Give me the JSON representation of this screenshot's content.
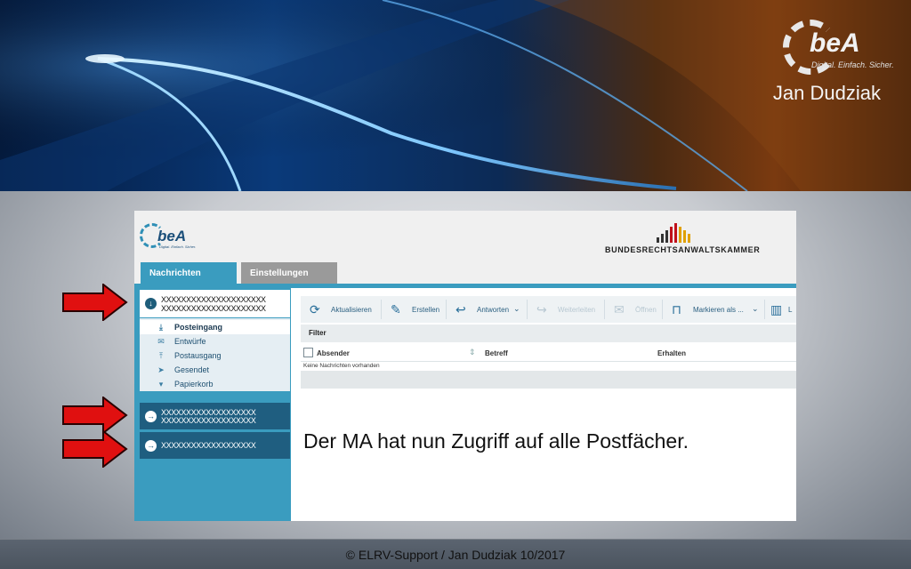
{
  "banner": {
    "brand_word": "beA",
    "brand_tagline": "Digital. Einfach. Sicher.",
    "author": "Jan Dudziak"
  },
  "app": {
    "logo_word": "beA",
    "logo_tagline": "Digital. Einfach. Sicher.",
    "partner_name": "BUNDESRECHTSANWALTSKAMMER",
    "tabs": [
      {
        "label": "Nachrichten",
        "active": true
      },
      {
        "label": "Einstellungen",
        "active": false
      }
    ],
    "account_primary": {
      "line1": "XXXXXXXXXXXXXXXXXXXXX",
      "line2": "XXXXXXXXXXXXXXXXXXXXX"
    },
    "folders": [
      {
        "label": "Posteingang",
        "icon": "inbox-icon",
        "selected": true
      },
      {
        "label": "Entwürfe",
        "icon": "envelope-icon",
        "selected": false
      },
      {
        "label": "Postausgang",
        "icon": "outbox-icon",
        "selected": false
      },
      {
        "label": "Gesendet",
        "icon": "send-icon",
        "selected": false
      },
      {
        "label": "Papierkorb",
        "icon": "trash-icon",
        "selected": false
      }
    ],
    "account_second": {
      "line1": "XXXXXXXXXXXXXXXXXXX",
      "line2": "XXXXXXXXXXXXXXXXXXX"
    },
    "account_third": {
      "line1": "XXXXXXXXXXXXXXXXXXX"
    },
    "toolbar": {
      "refresh": "Aktualisieren",
      "create": "Erstellen",
      "reply": "Antworten",
      "forward": "Weiterleiten",
      "open": "Öffnen",
      "mark": "Markieren als ...",
      "delete": "L"
    },
    "filter_label": "Filter",
    "columns": [
      "Absender",
      "Betreff",
      "Erhalten"
    ],
    "empty_text": "Keine Nachrichten vorhanden"
  },
  "caption": "Der MA hat nun Zugriff auf alle Postfächer.",
  "footer": "© ELRV-Support / Jan Dudziak 10/2017",
  "colors": {
    "accent": "#3a9cbf",
    "account_dark": "#1f5e80",
    "arrow_red": "#e01010"
  }
}
